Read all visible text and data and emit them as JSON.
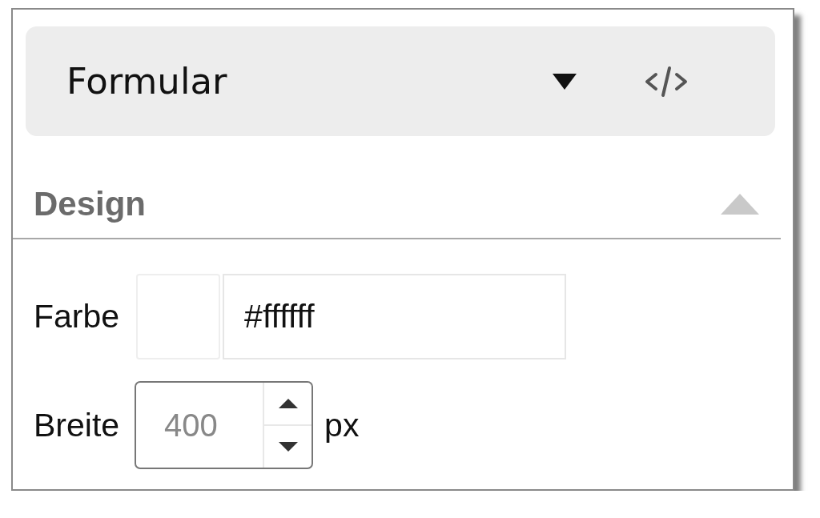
{
  "template_select": {
    "value": "Formular"
  },
  "section": {
    "title": "Design",
    "expanded": true,
    "fields": [
      {
        "kind": "color",
        "label": "Farbe",
        "value": "#ffffff"
      },
      {
        "kind": "number",
        "label": "Breite",
        "placeholder": "400",
        "unit": "px"
      }
    ]
  }
}
